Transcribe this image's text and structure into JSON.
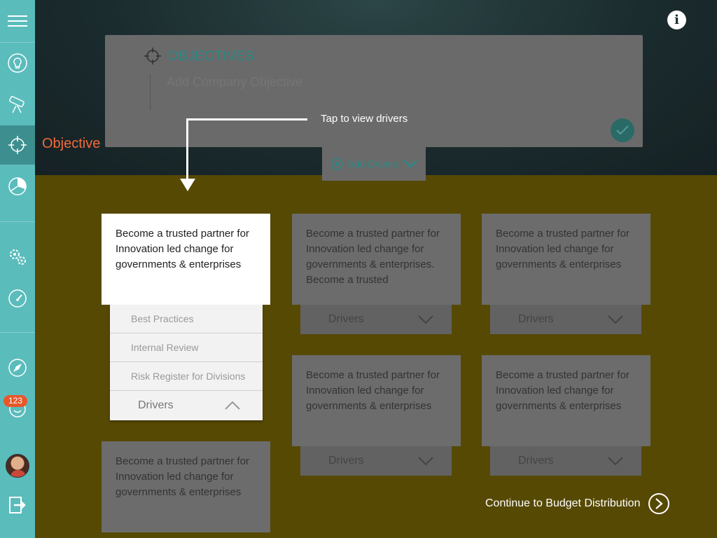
{
  "sidebar": {
    "active_label": "Objective",
    "badge_count": "123",
    "items": [
      {
        "icon": "menu-icon"
      },
      {
        "icon": "lightbulb-icon"
      },
      {
        "icon": "telescope-icon"
      },
      {
        "icon": "crosshair-icon",
        "active": true
      },
      {
        "icon": "pie-chart-icon"
      },
      {
        "icon": "gears-icon"
      },
      {
        "icon": "speedometer-icon"
      },
      {
        "icon": "compass-icon"
      },
      {
        "icon": "smiley-icon"
      },
      {
        "icon": "avatar"
      },
      {
        "icon": "logout-icon"
      }
    ]
  },
  "header": {
    "info_icon": "i"
  },
  "objectives": {
    "title": "OBJECTIVES",
    "placeholder": "Add Company Objective",
    "add_drivers_label": "Add Drivers"
  },
  "callout": {
    "text": "Tap to view drivers"
  },
  "cards": [
    {
      "text": "Become a trusted partner for Innovation led change for governments & enterprises",
      "drivers_label": "Drivers"
    },
    {
      "text": "Become a trusted partner for Innovation led change for governments & enterprises. Become a trusted",
      "drivers_label": "Drivers"
    },
    {
      "text": "Become a trusted partner for Innovation led change for governments & enterprises",
      "drivers_label": "Drivers"
    },
    {
      "text": "Become a trusted partner for Innovation led change for governments & enterprises",
      "drivers_label": "Drivers"
    },
    {
      "text": "Become a trusted partner for Innovation led change for governments & enterprises",
      "drivers_label": "Drivers"
    },
    {
      "text": "Become a trusted partner for Innovation led change for governments & enterprises"
    }
  ],
  "driver_list": {
    "items": [
      "Best Practices",
      "Internal Review",
      "Risk Register for Divisions"
    ],
    "footer_label": "Drivers"
  },
  "footer": {
    "continue_label": "Continue to Budget Distribution"
  },
  "colors": {
    "sidebar": "#5bbcbc",
    "accent_orange": "#f26a3a",
    "teal": "#2a8a86",
    "yellow_area": "#564904"
  }
}
